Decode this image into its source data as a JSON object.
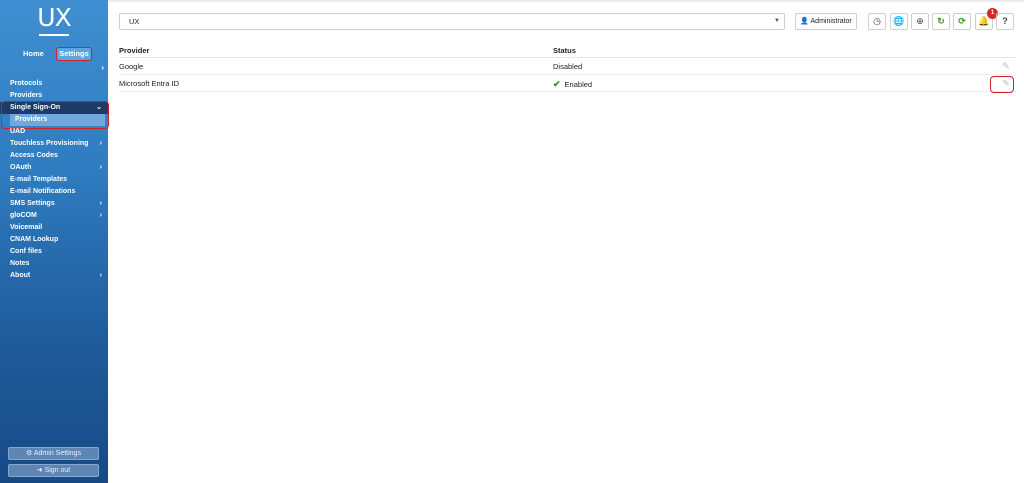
{
  "logo": "UX",
  "topnav": {
    "home": "Home",
    "settings": "Settings"
  },
  "sidebar": {
    "collapse_icon": "chevron-right-icon",
    "items": [
      {
        "label": "Protocols",
        "chev": ""
      },
      {
        "label": "Providers",
        "chev": ""
      },
      {
        "label": "Single Sign-On",
        "chev": "⌄"
      },
      {
        "label": "UAD",
        "chev": ""
      },
      {
        "label": "Touchless Provisioning",
        "chev": "›"
      },
      {
        "label": "Access Codes",
        "chev": ""
      },
      {
        "label": "OAuth",
        "chev": "›"
      },
      {
        "label": "E-mail Templates",
        "chev": ""
      },
      {
        "label": "E-mail Notifications",
        "chev": ""
      },
      {
        "label": "SMS Settings",
        "chev": "›"
      },
      {
        "label": "gloCOM",
        "chev": "›"
      },
      {
        "label": "Voicemail",
        "chev": ""
      },
      {
        "label": "CNAM Lookup",
        "chev": ""
      },
      {
        "label": "Conf files",
        "chev": ""
      },
      {
        "label": "Notes",
        "chev": ""
      },
      {
        "label": "About",
        "chev": "›"
      }
    ],
    "sub_item": "Providers",
    "admin_settings": "Admin Settings",
    "sign_out": "Sign out"
  },
  "toolbar": {
    "tenant_select": "UX",
    "user_button": "Administrator",
    "notification_count": "1",
    "help": "?"
  },
  "table": {
    "headers": {
      "provider": "Provider",
      "status": "Status"
    },
    "rows": [
      {
        "provider": "Google",
        "status": "Disabled"
      },
      {
        "provider": "Microsoft Entra ID",
        "status": "Enabled"
      }
    ]
  },
  "colors": {
    "sidebar": "#2f7cc0",
    "highlight": "#d0202a",
    "enabled": "#2a8a2a"
  }
}
